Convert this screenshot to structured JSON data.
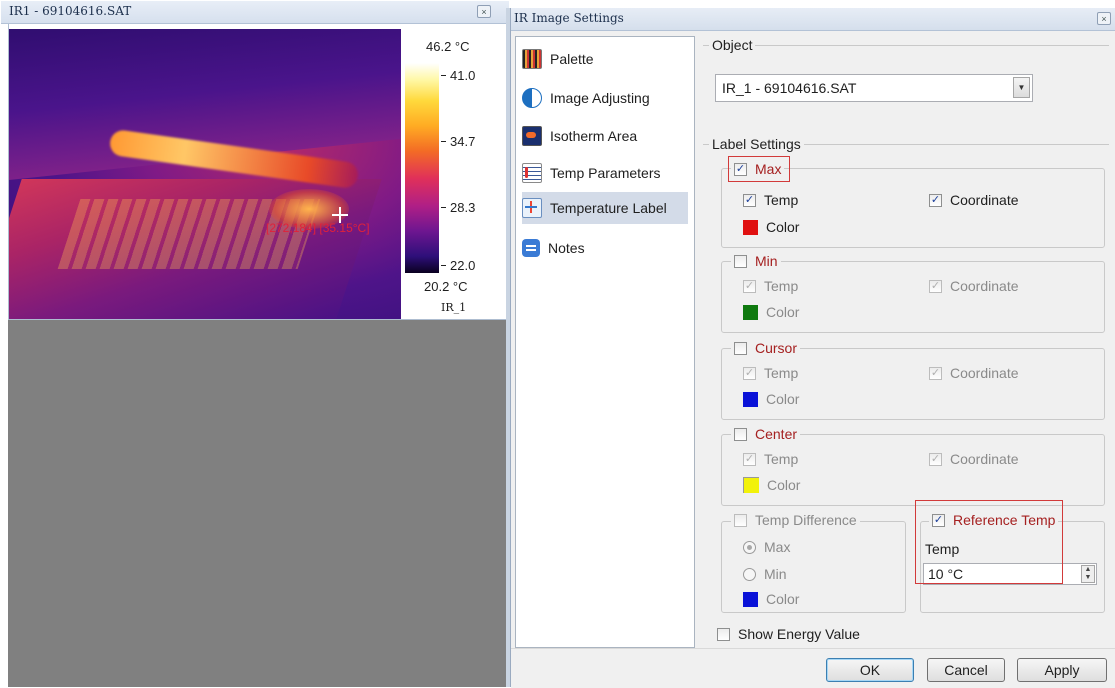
{
  "ir_window": {
    "title": "IR1 - 69104616.SAT",
    "close_label": "×",
    "max_label": "[272,184] [35.15°C]",
    "scale_max": "46.2 °C",
    "scale_min": "20.2 °C",
    "ticks": [
      "41.0",
      "34.7",
      "28.3",
      "22.0"
    ],
    "name": "IR_1"
  },
  "dialog": {
    "title": "IR Image Settings",
    "close_label": "×",
    "nav": [
      {
        "label": "Palette",
        "icon": "palette-icon"
      },
      {
        "label": "Image Adjusting",
        "icon": "contrast-icon"
      },
      {
        "label": "Isotherm Area",
        "icon": "isotherm-icon"
      },
      {
        "label": "Temp Parameters",
        "icon": "thermometer-icon"
      },
      {
        "label": "Temperature Label",
        "icon": "temperature-label-icon",
        "selected": true
      },
      {
        "label": "Notes",
        "icon": "notes-icon"
      }
    ],
    "object": {
      "legend": "Object",
      "value": "IR_1 - 69104616.SAT",
      "arrow": "▼"
    },
    "label_settings": {
      "legend": "Label Settings",
      "max": {
        "label": "Max",
        "checked": true,
        "temp": "Temp",
        "coordinate": "Coordinate",
        "color_label": "Color",
        "color": "#e01010"
      },
      "min": {
        "label": "Min",
        "checked": false,
        "temp": "Temp",
        "coordinate": "Coordinate",
        "color_label": "Color",
        "color": "#0f7a0f"
      },
      "cursor": {
        "label": "Cursor",
        "checked": false,
        "temp": "Temp",
        "coordinate": "Coordinate",
        "color_label": "Color",
        "color": "#0a12d8"
      },
      "center": {
        "label": "Center",
        "checked": false,
        "temp": "Temp",
        "coordinate": "Coordinate",
        "color_label": "Color",
        "color": "#f2f20a"
      },
      "temp_difference": {
        "label": "Temp Difference",
        "max": "Max",
        "min": "Min",
        "color_label": "Color",
        "color": "#0a12d8"
      },
      "reference_temp": {
        "label": "Reference Temp",
        "checked": true,
        "temp_label": "Temp",
        "value": "10 °C"
      },
      "show_energy": "Show Energy Value"
    },
    "buttons": {
      "ok": "OK",
      "cancel": "Cancel",
      "apply": "Apply"
    }
  }
}
